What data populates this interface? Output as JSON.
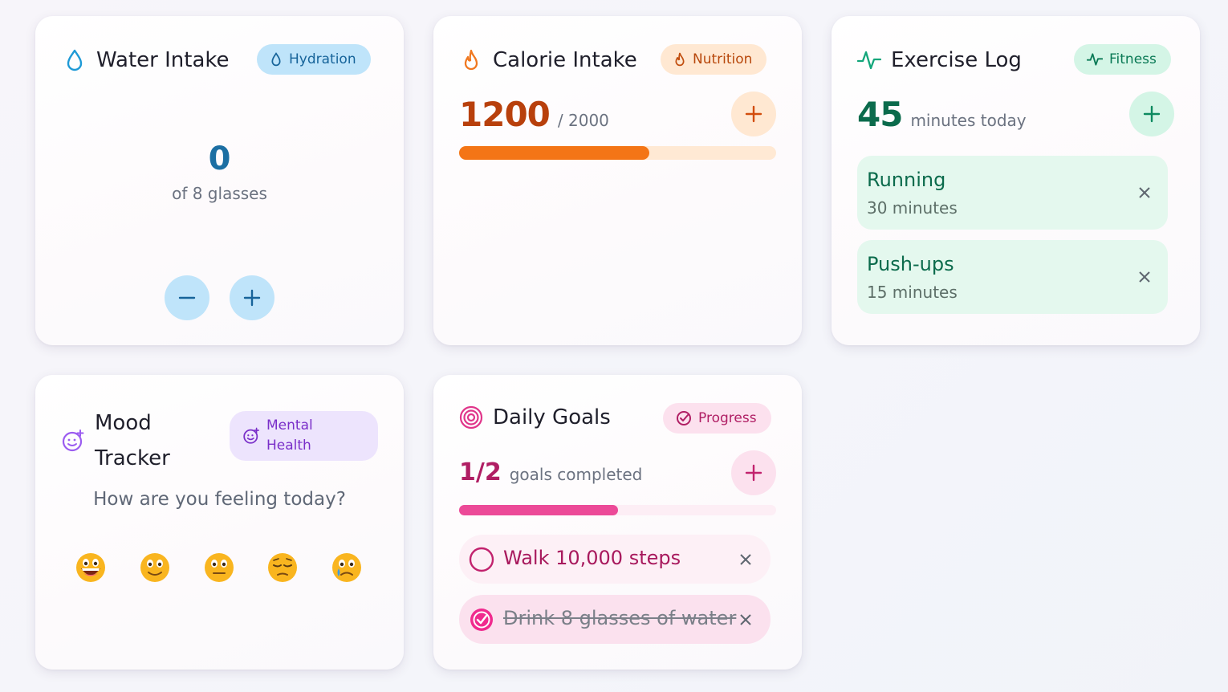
{
  "water": {
    "title": "Water Intake",
    "badge": "Hydration",
    "count": "0",
    "of_label": "of 8 glasses"
  },
  "calorie": {
    "title": "Calorie Intake",
    "badge": "Nutrition",
    "current": "1200",
    "goal": "/ 2000",
    "progress": 0.6
  },
  "exercise": {
    "title": "Exercise Log",
    "badge": "Fitness",
    "minutes": "45",
    "minutes_label": "minutes today",
    "items": [
      {
        "name": "Running",
        "duration": "30 minutes"
      },
      {
        "name": "Push-ups",
        "duration": "15 minutes"
      }
    ]
  },
  "mood": {
    "title_line1": "Mood",
    "title_line2": "Tracker",
    "badge_line1": "Mental",
    "badge_line2": "Health",
    "question": "How are you feeling today?",
    "options": [
      "grinning-face",
      "smiling-face",
      "neutral-face",
      "pensive-face",
      "crying-face"
    ]
  },
  "goals": {
    "title": "Daily Goals",
    "badge": "Progress",
    "completed": "1/2",
    "completed_label": "goals completed",
    "progress": 0.5,
    "items": [
      {
        "text": "Walk 10,000 steps",
        "done": false
      },
      {
        "text": "Drink 8 glasses of water",
        "done": true
      }
    ]
  },
  "colors": {
    "water": "#1e88c9",
    "calorie": "#f07820",
    "exercise": "#0e9e6e",
    "mood": "#8b5cf6",
    "goals": "#d6287a"
  }
}
